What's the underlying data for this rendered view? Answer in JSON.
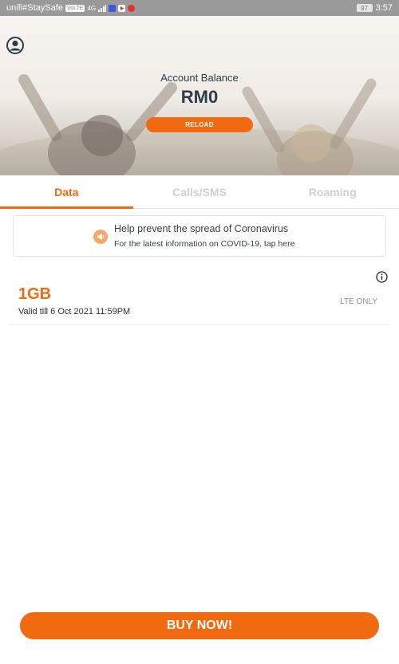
{
  "status_bar": {
    "carrier": "unifi#StaySafe",
    "badge": "VoLTE",
    "network": "4G",
    "battery": "97",
    "time": "3:57"
  },
  "hero": {
    "balance_label": "Account Balance",
    "balance_value": "RM0",
    "reload_label": "RELOAD"
  },
  "tabs": [
    {
      "label": "Data",
      "active": true
    },
    {
      "label": "Calls/SMS",
      "active": false
    },
    {
      "label": "Roaming",
      "active": false
    }
  ],
  "notice": {
    "title": "Help prevent the spread of Coronavirus",
    "subtitle": "For the latest information on COVID-19, tap here",
    "icon": "megaphone-icon"
  },
  "plan": {
    "size": "1GB",
    "tag": "LTE ONLY",
    "validity": "Valid till 6 Oct 2021 11:59PM"
  },
  "footer": {
    "buy_label": "BUY NOW!"
  },
  "colors": {
    "accent": "#f26a10",
    "text_dark": "#2f3a47",
    "tab_inactive": "#cfcfcf"
  }
}
